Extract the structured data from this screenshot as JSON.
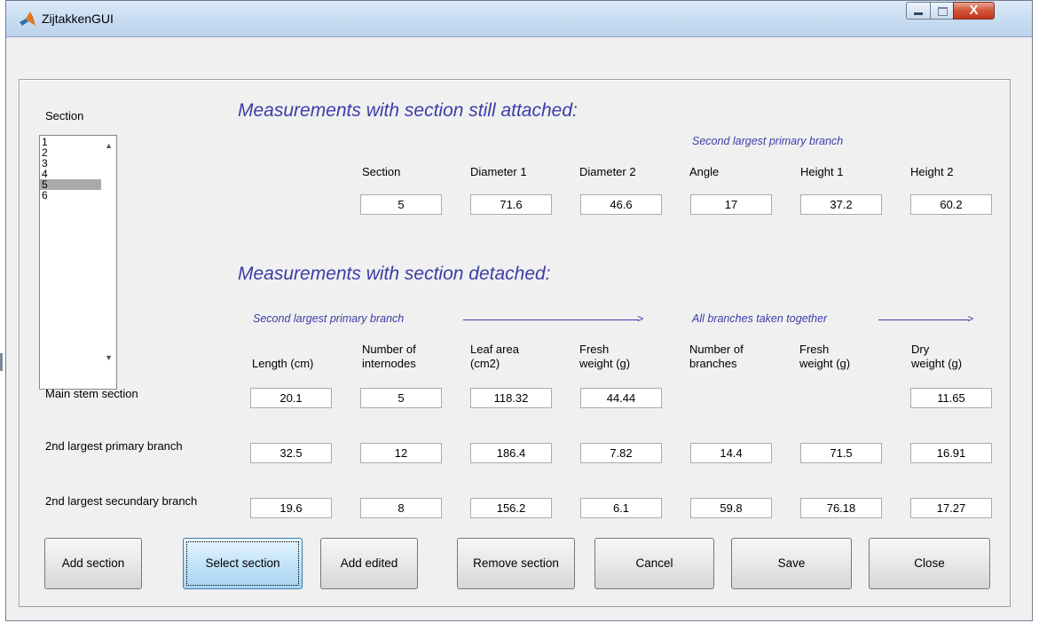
{
  "window": {
    "title": "ZijtakkenGUI",
    "close_glyph": "X",
    "icon": "matlab-logo-icon"
  },
  "section_list": {
    "label": "Section",
    "items": [
      "1",
      "2",
      "3",
      "4",
      "5",
      "6"
    ],
    "selected": "5"
  },
  "attached": {
    "heading": "Measurements with section still attached:",
    "subheading": "Second largest primary branch",
    "columns": [
      "Section",
      "Diameter 1",
      "Diameter 2",
      "Angle",
      "Height 1",
      "Height 2"
    ],
    "values": [
      "5",
      "71.6",
      "46.6",
      "17",
      "37.2",
      "60.2"
    ]
  },
  "detached": {
    "heading": "Measurements with section detached:",
    "subheading_left": "Second largest primary branch",
    "subheading_right": "All branches taken together",
    "arrow_glyph": ">",
    "columns": [
      [
        "Length (cm)",
        ""
      ],
      [
        "Number of",
        "internodes"
      ],
      [
        "Leaf area",
        "(cm2)"
      ],
      [
        "Fresh",
        "weight (g)"
      ],
      [
        "Number of",
        "branches"
      ],
      [
        "Fresh",
        "weight (g)"
      ],
      [
        "Dry",
        "weight (g)"
      ]
    ],
    "rows": [
      {
        "label": "Main stem section",
        "values": [
          "20.1",
          "5",
          "118.32",
          "44.44",
          null,
          null,
          "11.65"
        ]
      },
      {
        "label": "2nd largest primary branch",
        "values": [
          "32.5",
          "12",
          "186.4",
          "7.82",
          "14.4",
          "71.5",
          "16.91"
        ]
      },
      {
        "label": "2nd largest secundary branch",
        "values": [
          "19.6",
          "8",
          "156.2",
          "6.1",
          "59.8",
          "76.18",
          "17.27"
        ]
      }
    ]
  },
  "buttons": {
    "add_section": "Add section",
    "select_section": "Select section",
    "add_edited": "Add edited",
    "remove_section": "Remove section",
    "cancel": "Cancel",
    "save": "Save",
    "close": "Close"
  },
  "colors": {
    "heading": "#3c3ca8",
    "selected_item": "#aaaaaa",
    "active_button": "#c3e3f8"
  }
}
